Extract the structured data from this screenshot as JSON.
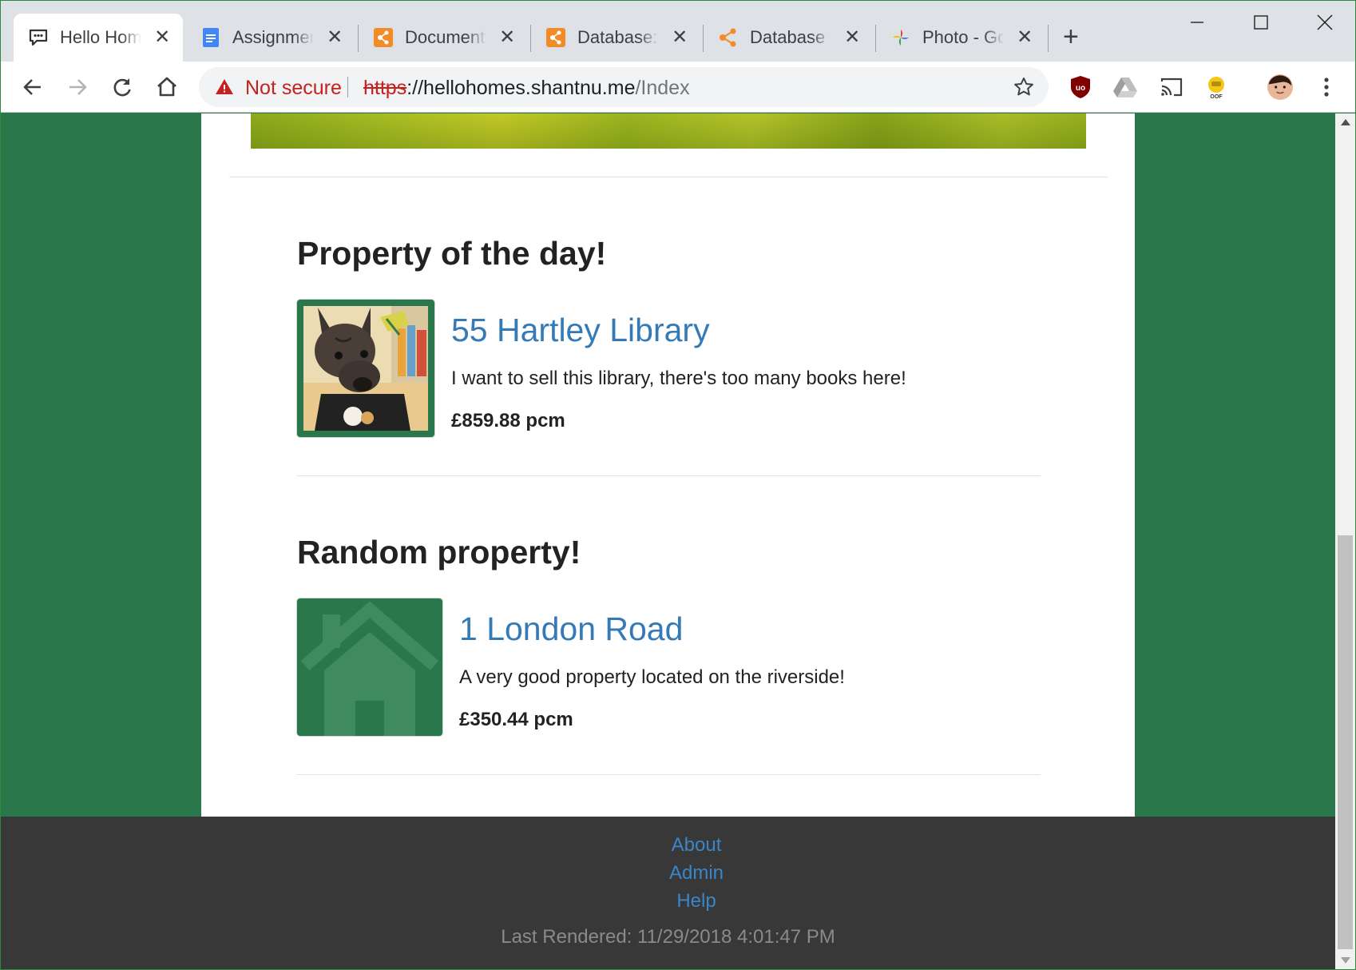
{
  "browser": {
    "tabs": [
      {
        "title": "Hello Home",
        "icon": "chat-bubble-icon",
        "active": true
      },
      {
        "title": "Assignment",
        "icon": "google-docs-icon",
        "active": false
      },
      {
        "title": "Documents",
        "icon": "azure-devops-icon",
        "active": false
      },
      {
        "title": "Database: L",
        "icon": "azure-devops-icon",
        "active": false
      },
      {
        "title": "Database D",
        "icon": "share-nodes-icon",
        "active": false
      },
      {
        "title": "Photo - Go",
        "icon": "google-photos-icon",
        "active": false
      }
    ],
    "new_tab_label": "+",
    "close_glyph": "✕",
    "security_label": "Not secure",
    "url": {
      "scheme": "https",
      "host": "://hellohomes.shantnu.me",
      "path": "/Index"
    },
    "extensions": [
      "ublock-origin-icon",
      "google-drive-icon",
      "cast-icon",
      "oof-extension-icon",
      "profile-avatar-icon",
      "menu-kebab-icon"
    ],
    "colors": {
      "tabstrip": "#dee1e6",
      "not_secure_red": "#c5221f"
    }
  },
  "page": {
    "colors": {
      "background_green": "#2a774b",
      "link_blue": "#337ab7",
      "footer_dark": "#383838"
    },
    "featured": {
      "heading": "Property of the day!",
      "name": "55 Hartley Library",
      "description": "I want to sell this library, there's too many books here!",
      "price": "£859.88 pcm",
      "image_icon": "dog-photo"
    },
    "random": {
      "heading": "Random property!",
      "name": "1 London Road",
      "description": "A very good property located on the riverside!",
      "price": "£350.44 pcm",
      "image_icon": "house-placeholder-icon"
    },
    "footer": {
      "links": [
        "About",
        "Admin",
        "Help"
      ],
      "last_rendered": "Last Rendered: 11/29/2018 4:01:47 PM"
    }
  }
}
